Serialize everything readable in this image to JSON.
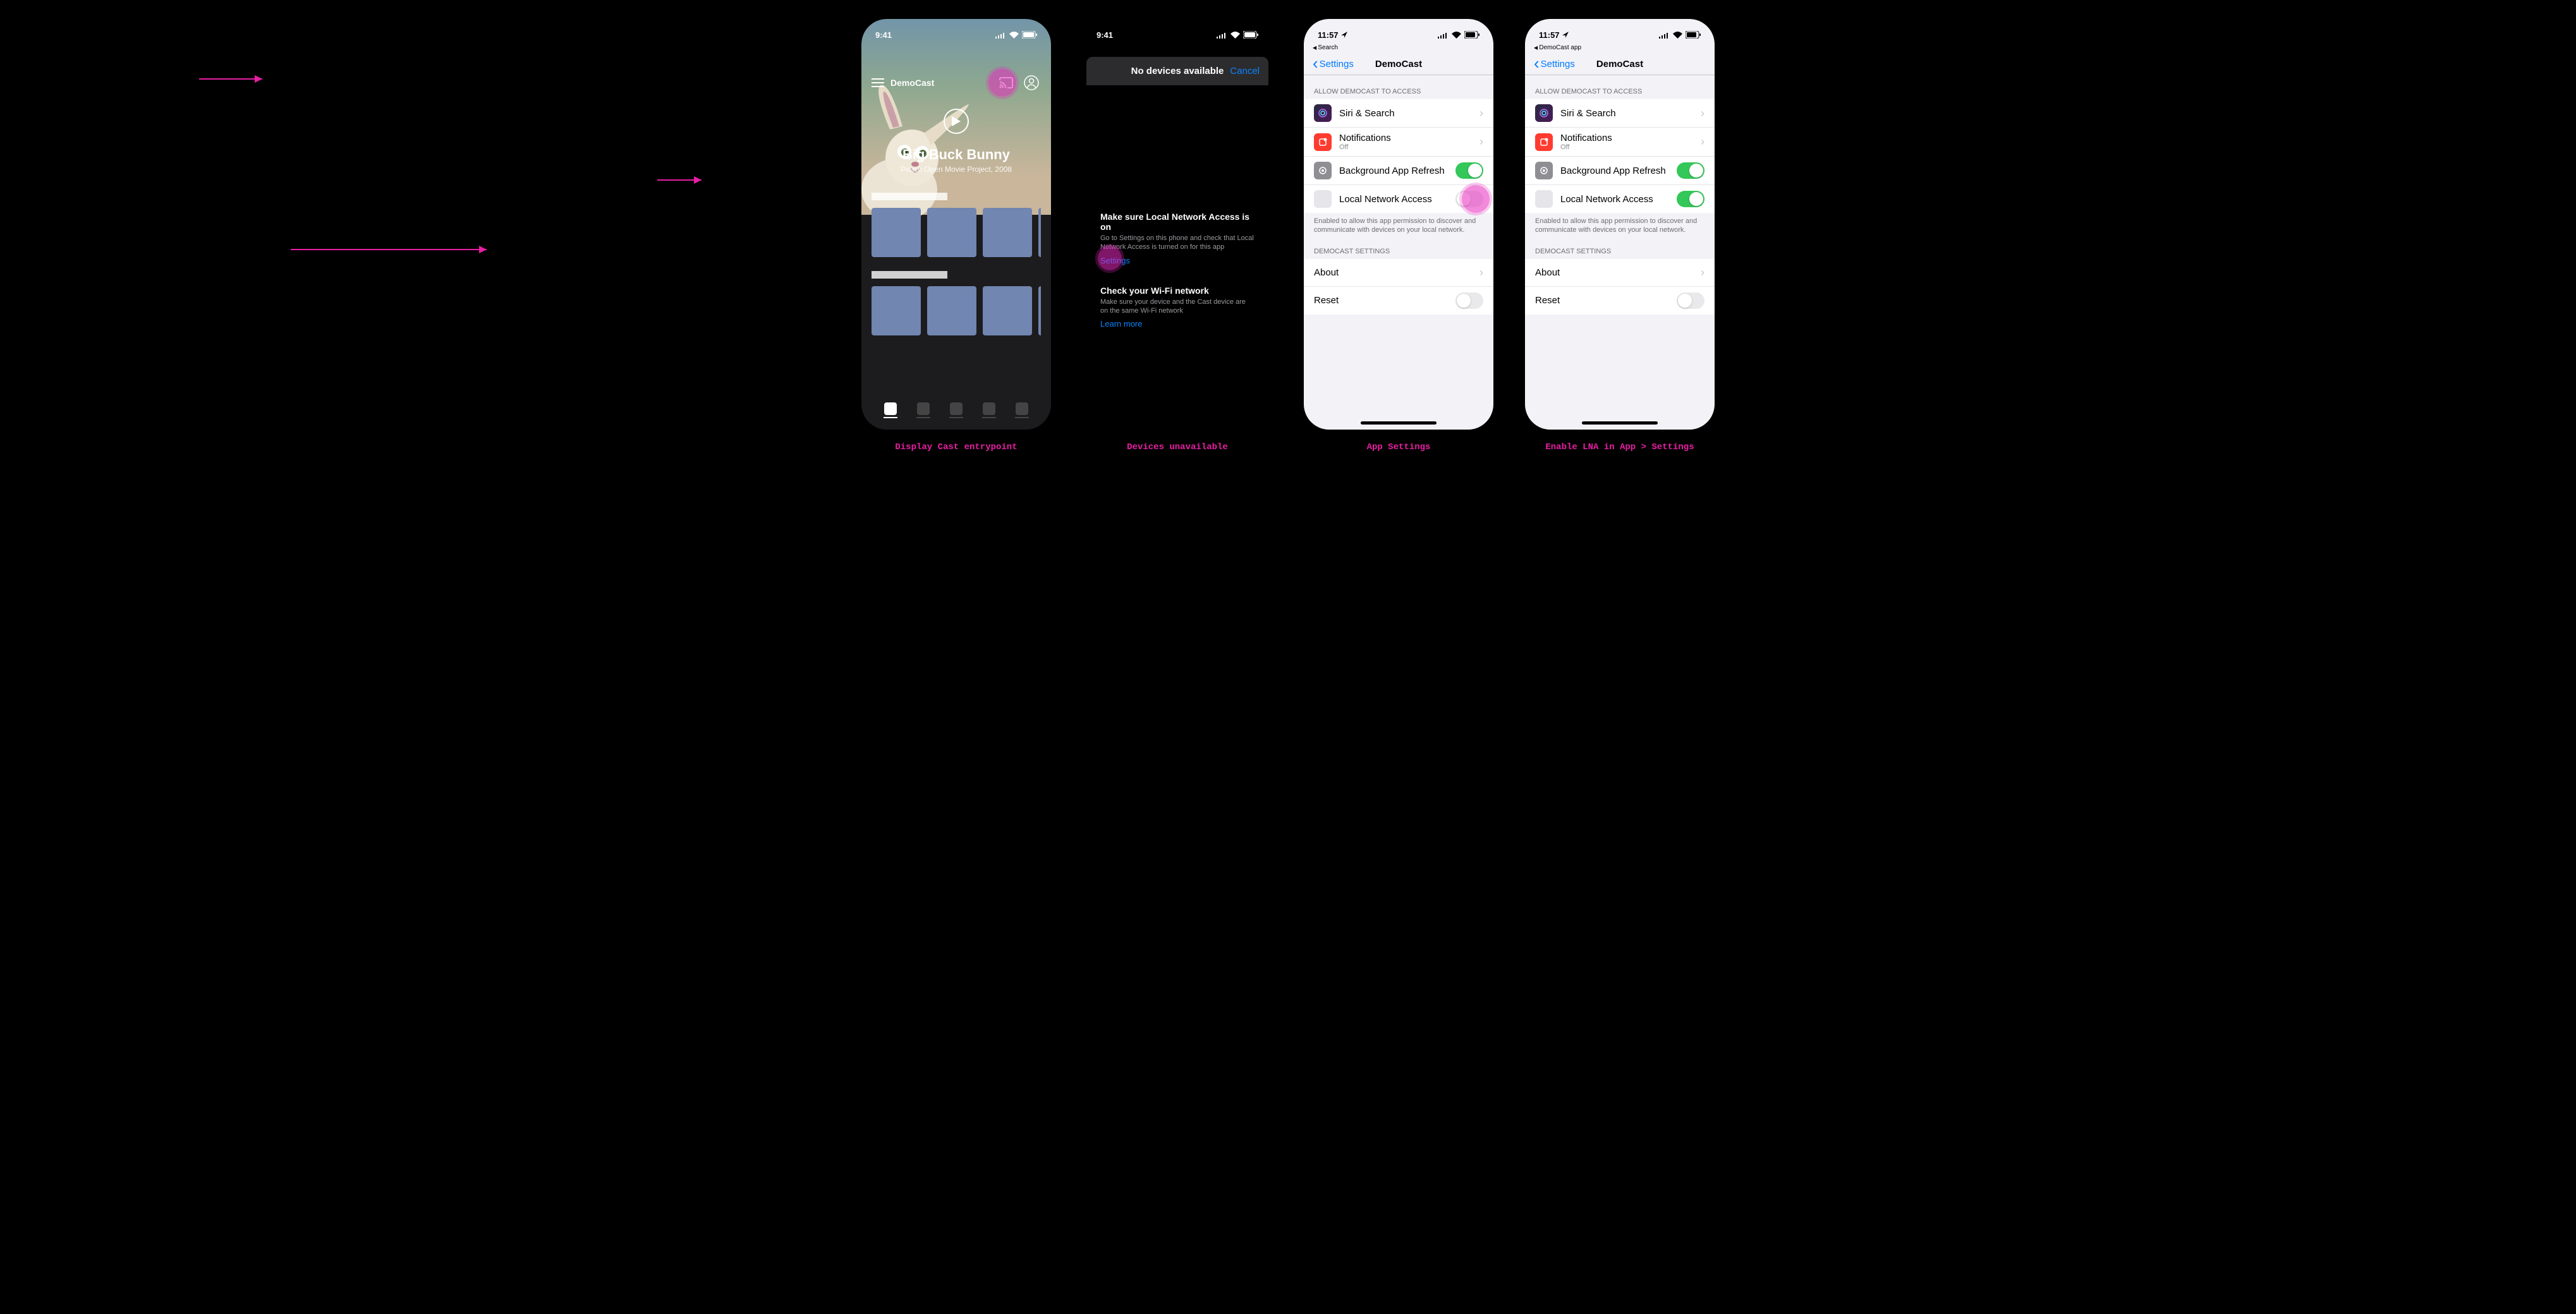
{
  "status_time_s1": "9:41",
  "status_time_s2": "9:41",
  "status_time_s3": "11:57",
  "status_time_s4": "11:57",
  "screen1": {
    "app_name": "DemoCast",
    "video_title": "Big Buck Bunny",
    "video_sub": "Peach Open Movie Project, 2008",
    "caption": "Display Cast entrypoint"
  },
  "screen2": {
    "header": "No devices available",
    "cancel": "Cancel",
    "h1": "Make sure Local Network Access is on",
    "p1": "Go to Settings on this phone and check that Local Network Access is turned on for this app",
    "link1": "Settings",
    "h2": "Check your Wi-Fi network",
    "p2": "Make sure your device and the Cast device are on the same Wi-Fi network",
    "link2": "Learn more",
    "caption": "Devices unavailable"
  },
  "settings_common": {
    "breadcrumb_search": "Search",
    "breadcrumb_app": "DemoCast app",
    "back": "Settings",
    "title": "DemoCast",
    "section_allow": "ALLOW DEMOCAST TO ACCESS",
    "siri": "Siri & Search",
    "notifications": "Notifications",
    "notifications_sub": "Off",
    "background": "Background App Refresh",
    "lna": "Local Network Access",
    "lna_footer": "Enabled to allow this app permission to discover and communicate with devices on your local network.",
    "section_app": "DEMOCAST SETTINGS",
    "about": "About",
    "reset": "Reset"
  },
  "screen3": {
    "caption": "App Settings"
  },
  "screen4": {
    "caption": "Enable LNA in App > Settings"
  }
}
